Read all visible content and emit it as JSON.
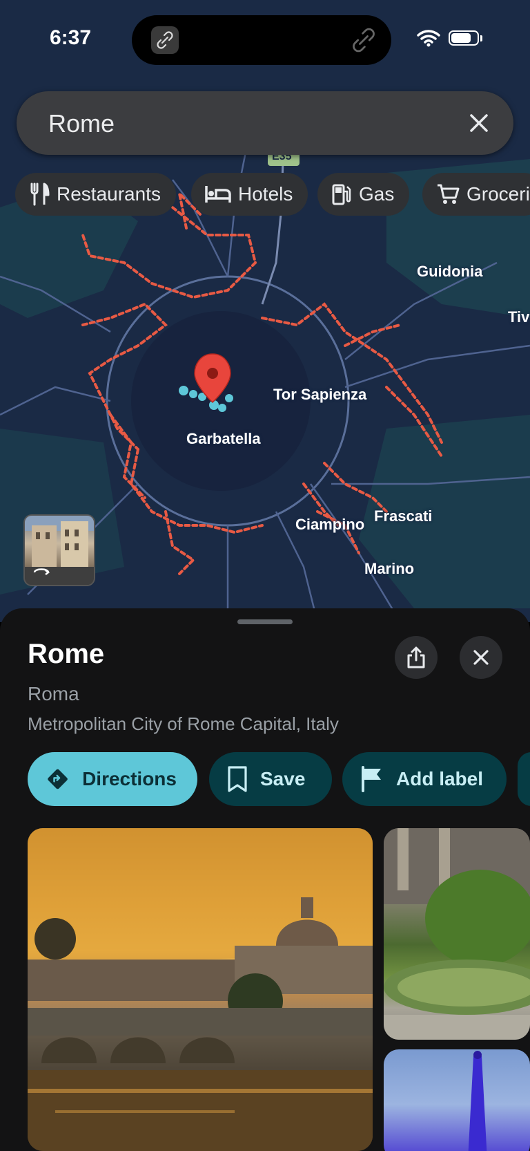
{
  "status_bar": {
    "time": "6:37"
  },
  "search": {
    "query": "Rome"
  },
  "chips": [
    {
      "label": "Restaurants",
      "icon": "fork-knife-icon"
    },
    {
      "label": "Hotels",
      "icon": "bed-icon"
    },
    {
      "label": "Gas",
      "icon": "gas-pump-icon"
    },
    {
      "label": "Groceri",
      "icon": "cart-icon"
    }
  ],
  "map": {
    "labels": {
      "guidonia": "Guidonia",
      "tivoli": "Tiv",
      "tor_sapienza": "Tor Sapienza",
      "garbatella": "Garbatella",
      "frascati": "Frascati",
      "ciampino": "Ciampino",
      "marino": "Marino",
      "road_shield": "E35"
    },
    "pin_color": "#e8453c",
    "traffic_color": "#e85a44"
  },
  "place": {
    "title": "Rome",
    "subtitle": "Roma",
    "address": "Metropolitan City of Rome Capital, Italy"
  },
  "actions": {
    "directions": "Directions",
    "save": "Save",
    "add_label": "Add label"
  },
  "colors": {
    "accent": "#5ec7d8",
    "sheet_bg": "#131314"
  }
}
